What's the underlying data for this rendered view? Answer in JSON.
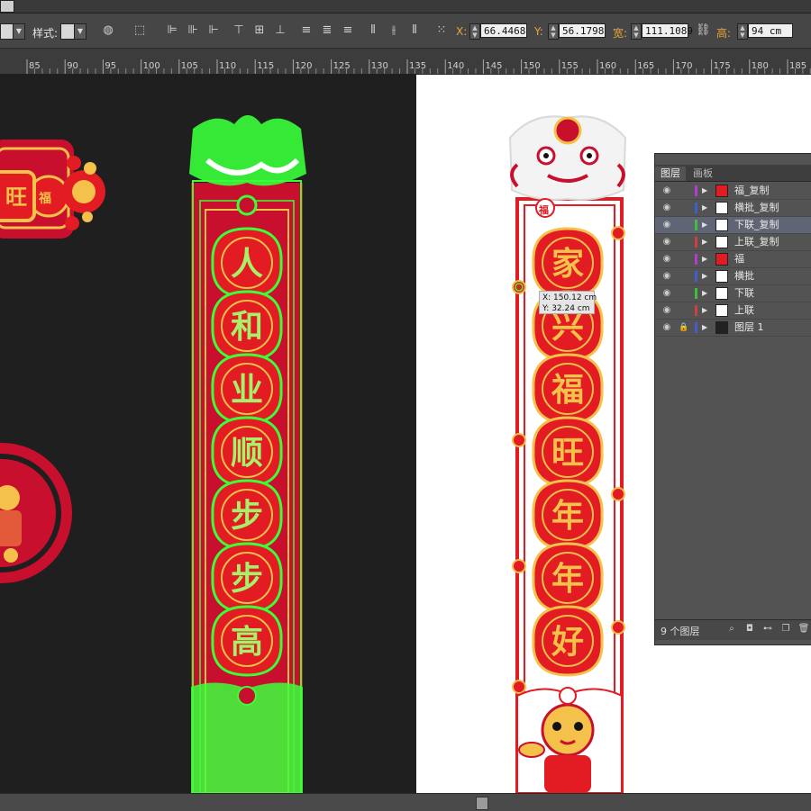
{
  "toolbar": {
    "style_label": "样式:",
    "x_label": "X:",
    "x_value": "66.4468",
    "y_label": "Y:",
    "y_value": "56.1798",
    "width_label": "宽:",
    "width_value": "111.1089",
    "height_label": "高:",
    "height_value": "94 cm"
  },
  "ruler": {
    "ticks": [
      "85",
      "90",
      "95",
      "100",
      "105",
      "110",
      "115",
      "120",
      "125",
      "130",
      "135",
      "140",
      "145",
      "150",
      "155",
      "160",
      "165",
      "170",
      "175",
      "180",
      "185"
    ]
  },
  "artboard_left": {
    "partial_char": "旺",
    "partial_fu": "福",
    "couplet_chars": [
      "人",
      "和",
      "业",
      "顺",
      "步",
      "步",
      "高"
    ]
  },
  "artboard_right": {
    "top_fu": "福",
    "couplet_chars": [
      "家",
      "兴",
      "福",
      "旺",
      "年",
      "年",
      "好"
    ]
  },
  "tooltip": {
    "x": "X: 150.12 cm",
    "y": "Y: 32.24 cm"
  },
  "panel": {
    "tab_layers": "图层",
    "tab_artboards": "画板",
    "layers": [
      {
        "name": "福_复制",
        "color": "#b03fd0"
      },
      {
        "name": "横批_复制",
        "color": "#3f5fd0"
      },
      {
        "name": "下联_复制",
        "color": "#3fbf3f"
      },
      {
        "name": "上联_复制",
        "color": "#d03f3f"
      },
      {
        "name": "福",
        "color": "#b03fd0"
      },
      {
        "name": "横批",
        "color": "#3f5fd0"
      },
      {
        "name": "下联",
        "color": "#3fbf3f"
      },
      {
        "name": "上联",
        "color": "#d03f3f"
      },
      {
        "name": "图层 1",
        "color": "#3f5fd0"
      }
    ],
    "layer_count": "9 个图层"
  }
}
